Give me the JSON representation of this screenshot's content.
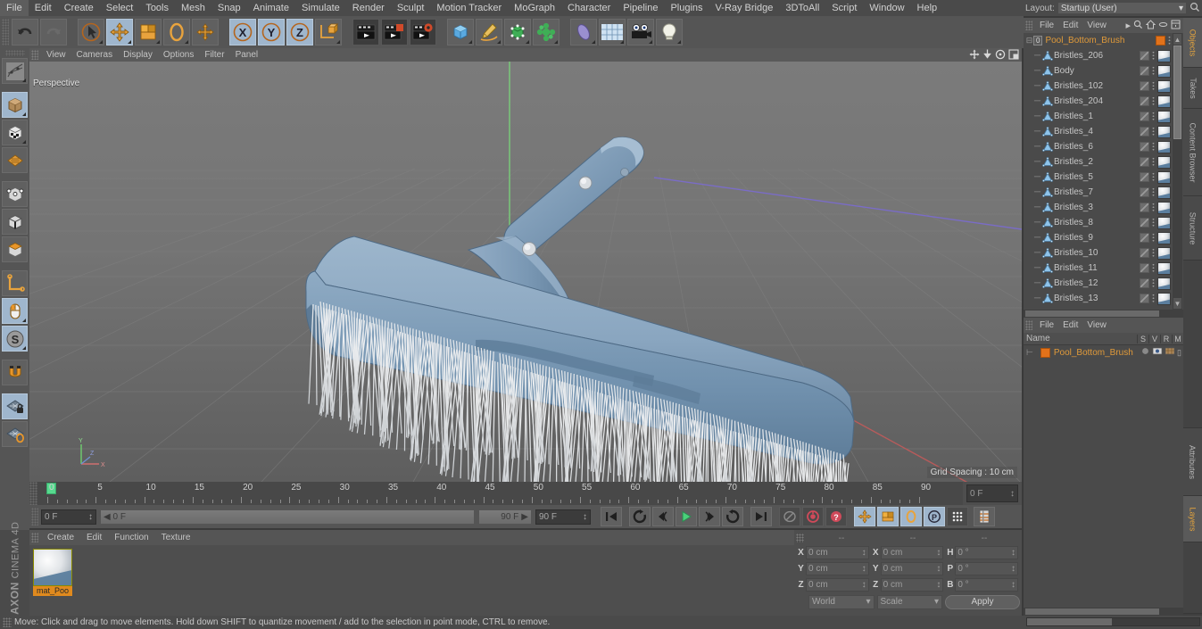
{
  "menubar": {
    "items": [
      "File",
      "Edit",
      "Create",
      "Select",
      "Tools",
      "Mesh",
      "Snap",
      "Animate",
      "Simulate",
      "Render",
      "Sculpt",
      "Motion Tracker",
      "MoGraph",
      "Character",
      "Pipeline",
      "Plugins",
      "V-Ray Bridge",
      "3DToAll",
      "Script",
      "Window",
      "Help"
    ]
  },
  "layout": {
    "label": "Layout:",
    "value": "Startup (User)"
  },
  "viewport": {
    "menu": [
      "View",
      "Cameras",
      "Display",
      "Options",
      "Filter",
      "Panel"
    ],
    "perspective_label": "Perspective",
    "grid_spacing": "Grid Spacing : 10 cm",
    "axis_labels": {
      "x": "X",
      "y": "Y",
      "z": "Z"
    }
  },
  "object_manager": {
    "menu": [
      "File",
      "Edit",
      "View"
    ],
    "root": {
      "name": "Pool_Bottom_Brush",
      "layer_badge": "0"
    },
    "items": [
      {
        "name": "Bristles_206"
      },
      {
        "name": "Body"
      },
      {
        "name": "Bristles_102"
      },
      {
        "name": "Bristles_204"
      },
      {
        "name": "Bristles_1"
      },
      {
        "name": "Bristles_4"
      },
      {
        "name": "Bristles_6"
      },
      {
        "name": "Bristles_2"
      },
      {
        "name": "Bristles_5"
      },
      {
        "name": "Bristles_7"
      },
      {
        "name": "Bristles_3"
      },
      {
        "name": "Bristles_8"
      },
      {
        "name": "Bristles_9"
      },
      {
        "name": "Bristles_10"
      },
      {
        "name": "Bristles_11"
      },
      {
        "name": "Bristles_12"
      },
      {
        "name": "Bristles_13"
      }
    ]
  },
  "layer_manager": {
    "menu": [
      "File",
      "Edit",
      "View"
    ],
    "columns": [
      "Name",
      "S",
      "V",
      "R",
      "M"
    ],
    "rows": [
      {
        "name": "Pool_Bottom_Brush"
      }
    ]
  },
  "vertical_tabs": [
    "Objects",
    "Takes",
    "Content Browser",
    "Structure",
    "Attributes",
    "Layers"
  ],
  "timeline": {
    "ticks": [
      "0",
      "5",
      "10",
      "15",
      "20",
      "25",
      "30",
      "35",
      "40",
      "45",
      "50",
      "55",
      "60",
      "65",
      "70",
      "75",
      "80",
      "85",
      "90"
    ],
    "frame_field": "0 F",
    "playhead_frame": 0
  },
  "playback": {
    "current_frame": "0 F",
    "range_start": "0 F",
    "range_end_label": "90 F",
    "end_frame": "90 F"
  },
  "material_manager": {
    "menu": [
      "Create",
      "Edit",
      "Function",
      "Texture"
    ],
    "materials": [
      {
        "name": "mat_Poo"
      }
    ]
  },
  "coordinates": {
    "headers": [
      "--",
      "--",
      "--"
    ],
    "position": {
      "label_x": "X",
      "label_y": "Y",
      "label_z": "Z",
      "x": "0 cm",
      "y": "0 cm",
      "z": "0 cm"
    },
    "size": {
      "label_x": "X",
      "label_y": "Y",
      "label_z": "Z",
      "x": "0 cm",
      "y": "0 cm",
      "z": "0 cm"
    },
    "rotation": {
      "label_h": "H",
      "label_p": "P",
      "label_b": "B",
      "h": "0 °",
      "p": "0 °",
      "b": "0 °"
    },
    "system": "World",
    "mode": "Scale",
    "apply": "Apply"
  },
  "statusbar": {
    "text": "Move: Click and drag to move elements. Hold down SHIFT to quantize movement / add to the selection in point mode, CTRL to remove."
  },
  "branding": {
    "line1": "MAXON",
    "line2": "CINEMA 4D"
  },
  "colors": {
    "accent_orange": "#e2721a",
    "selection_blue": "#9fb6cd",
    "panel_bg": "#4a4a4a",
    "toolbar_bg": "#555555",
    "playhead_green": "#57d98e",
    "model_blue": "#7d9ab5"
  }
}
